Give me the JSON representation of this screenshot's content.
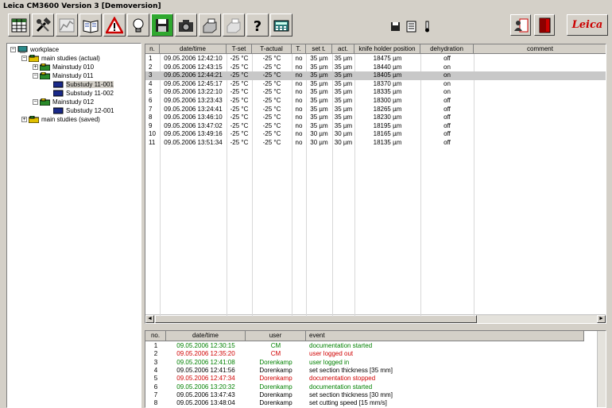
{
  "window": {
    "title": "Leica CM3600 Version 3  [Demoversion]"
  },
  "toolbar": {
    "buttons": [
      {
        "name": "table-view-button",
        "icon": "table-icon"
      },
      {
        "name": "tools-button",
        "icon": "hammer-icon"
      },
      {
        "name": "chart-button",
        "icon": "chart-icon"
      },
      {
        "name": "book-button",
        "icon": "book-icon"
      },
      {
        "name": "warning-button",
        "icon": "warning-icon"
      },
      {
        "name": "lamp-button",
        "icon": "lamp-icon"
      },
      {
        "name": "save-button",
        "icon": "floppy-icon"
      },
      {
        "name": "camera-button",
        "icon": "camera-icon"
      },
      {
        "name": "print-button",
        "icon": "printer-icon"
      },
      {
        "name": "fax-button",
        "icon": "fax-icon"
      },
      {
        "name": "help-button",
        "icon": "question-icon"
      },
      {
        "name": "calculator-button",
        "icon": "calculator-icon"
      }
    ],
    "small_icons": [
      "floppy-icon",
      "list-icon",
      "thermometer-icon"
    ],
    "user_button": "user-login-icon",
    "exit_button": "exit-door-icon",
    "brand": "Leica"
  },
  "tree": {
    "root": "workplace",
    "actual": "main studies (actual)",
    "ms010": "Mainstudy 010",
    "ms011": "Mainstudy 011",
    "ss11001": "Substudy 11-001",
    "ss11002": "Substudy 11-002",
    "ms012": "Mainstudy 012",
    "ss12001": "Substudy 12-001",
    "saved": "main studies (saved)"
  },
  "grid": {
    "columns": [
      "n.",
      "date/time",
      "T-set",
      "T-actual",
      "T.",
      "set t.",
      "act.",
      "knife holder position",
      "dehydration",
      "comment"
    ],
    "rows": [
      [
        "1",
        "09.05.2006 12:42:10",
        "-25 °C",
        "-25 °C",
        "no",
        "35 µm",
        "35 µm",
        "18475 µm",
        "off",
        ""
      ],
      [
        "2",
        "09.05.2006 12:43:15",
        "-25 °C",
        "-25 °C",
        "no",
        "35 µm",
        "35 µm",
        "18440 µm",
        "on",
        ""
      ],
      [
        "3",
        "09.05.2006 12:44:21",
        "-25 °C",
        "-25 °C",
        "no",
        "35 µm",
        "35 µm",
        "18405 µm",
        "on",
        ""
      ],
      [
        "4",
        "09.05.2006 12:45:17",
        "-25 °C",
        "-25 °C",
        "no",
        "35 µm",
        "35 µm",
        "18370 µm",
        "on",
        ""
      ],
      [
        "5",
        "09.05.2006 13:22:10",
        "-25 °C",
        "-25 °C",
        "no",
        "35 µm",
        "35 µm",
        "18335 µm",
        "on",
        ""
      ],
      [
        "6",
        "09.05.2006 13:23:43",
        "-25 °C",
        "-25 °C",
        "no",
        "35 µm",
        "35 µm",
        "18300 µm",
        "off",
        ""
      ],
      [
        "7",
        "09.05.2006 13:24:41",
        "-25 °C",
        "-25 °C",
        "no",
        "35 µm",
        "35 µm",
        "18265 µm",
        "off",
        ""
      ],
      [
        "8",
        "09.05.2006 13:46:10",
        "-25 °C",
        "-25 °C",
        "no",
        "35 µm",
        "35 µm",
        "18230 µm",
        "off",
        ""
      ],
      [
        "9",
        "09.05.2006 13:47:02",
        "-25 °C",
        "-25 °C",
        "no",
        "35 µm",
        "35 µm",
        "18195 µm",
        "off",
        ""
      ],
      [
        "10",
        "09.05.2006 13:49:16",
        "-25 °C",
        "-25 °C",
        "no",
        "30 µm",
        "30 µm",
        "18165 µm",
        "off",
        ""
      ],
      [
        "11",
        "09.05.2006 13:51:34",
        "-25 °C",
        "-25 °C",
        "no",
        "30 µm",
        "30 µm",
        "18135 µm",
        "off",
        ""
      ]
    ],
    "selected_row": 3
  },
  "log": {
    "columns": [
      "no.",
      "date/time",
      "user",
      "event"
    ],
    "rows": [
      {
        "no": "1",
        "time": "09.05.2006 12:30:15",
        "user": "CM",
        "event": "documentation started",
        "color": "green"
      },
      {
        "no": "2",
        "time": "09.05.2006 12:35:20",
        "user": "CM",
        "event": "user logged out",
        "color": "red"
      },
      {
        "no": "3",
        "time": "09.05.2006 12:41:08",
        "user": "Dorenkamp",
        "event": "user logged in",
        "color": "green"
      },
      {
        "no": "4",
        "time": "09.05.2006 12:41:56",
        "user": "Dorenkamp",
        "event": "set section thickness [35 mm]",
        "color": "black"
      },
      {
        "no": "5",
        "time": "09.05.2006 12:47:34",
        "user": "Dorenkamp",
        "event": "documentation stopped",
        "color": "red"
      },
      {
        "no": "6",
        "time": "09.05.2006 13:20:32",
        "user": "Dorenkamp",
        "event": "documentation started",
        "color": "green"
      },
      {
        "no": "7",
        "time": "09.05.2006 13:47:43",
        "user": "Dorenkamp",
        "event": "set section thickness [30 mm]",
        "color": "black"
      },
      {
        "no": "8",
        "time": "09.05.2006 13:48:04",
        "user": "Dorenkamp",
        "event": "set cutting speed [15 mm/s]",
        "color": "black"
      }
    ]
  },
  "scroll": {
    "left": "◄",
    "right": "►"
  },
  "titlebar_controls": {
    "minimize": "_",
    "maximize": "□",
    "close": "×"
  },
  "tree_expanders": {
    "expanded": "−",
    "collapsed": "+"
  }
}
